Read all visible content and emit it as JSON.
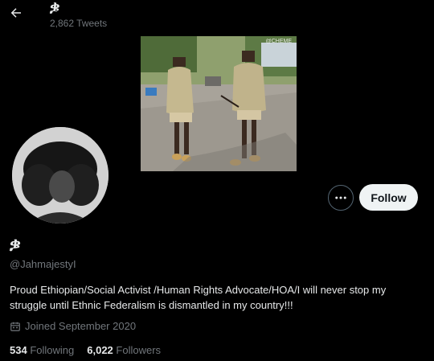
{
  "header": {
    "display_name": "ቌ",
    "tweet_count": "2,862 Tweets"
  },
  "banner": {
    "watermark": "@CHEME",
    "description_icon": "photo-of-two-men-walking"
  },
  "profile": {
    "display_name": "ቌ",
    "handle": "@JahmajestyI",
    "bio": "Proud Ethiopian/Social Activist /Human Rights Advocate/HOA/I will never stop my struggle until Ethnic Federalism is dismantled in my country!!!",
    "joined": "Joined September 2020",
    "following_count": "534",
    "following_label": "Following",
    "followers_count": "6,022",
    "followers_label": "Followers"
  },
  "actions": {
    "follow_label": "Follow"
  },
  "colors": {
    "background": "#000000",
    "primary_text": "#e7e9ea",
    "secondary_text": "#71767b",
    "follow_bg": "#eff3f4",
    "border": "#536471"
  }
}
